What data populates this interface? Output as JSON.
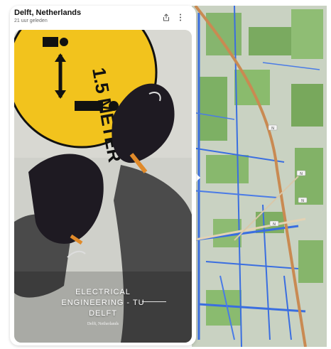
{
  "card": {
    "title": "Delft, Netherlands",
    "subtitle": "21 uur geleden",
    "share_icon": "share-icon",
    "more_icon": "more-vertical-icon"
  },
  "snap": {
    "caption_line1": "ELECTRICAL",
    "caption_line2": "ENGINEERING - TU",
    "caption_line3": "DELFT",
    "caption_sub": "Delft, Netherlands",
    "floor_sign_text": "1.5 METER"
  },
  "map": {
    "road_labels": [
      "N",
      "N",
      "N",
      "N"
    ]
  },
  "colors": {
    "sign_yellow": "#f2c31d",
    "map_green": "#7fb069",
    "water_blue": "#3a6ee0",
    "road_orange": "#c98a52"
  }
}
